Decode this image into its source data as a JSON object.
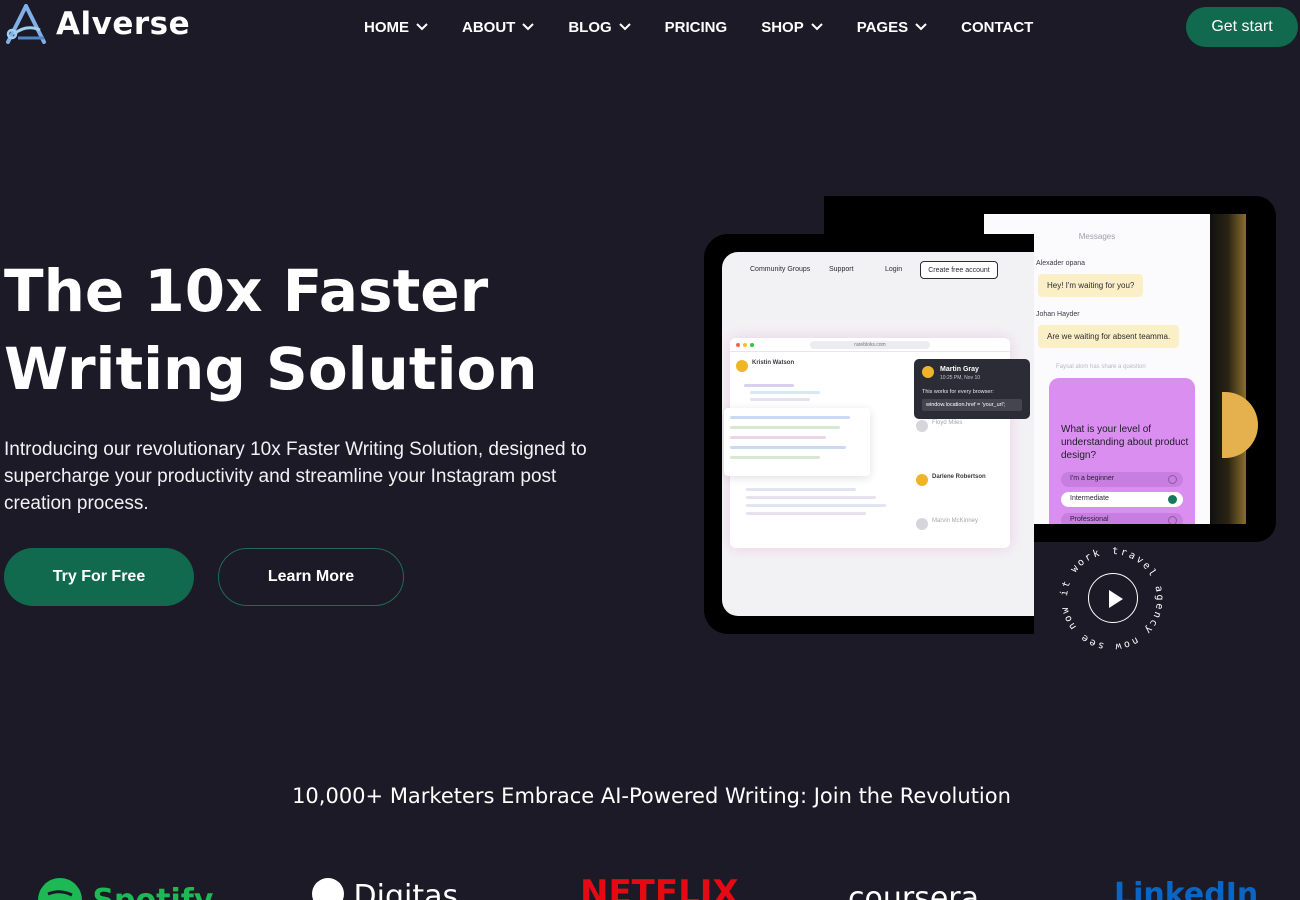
{
  "brand": {
    "name": "Alverse"
  },
  "nav": {
    "items": [
      {
        "label": "HOME",
        "has_dropdown": true
      },
      {
        "label": "ABOUT",
        "has_dropdown": true
      },
      {
        "label": "BLOG",
        "has_dropdown": true
      },
      {
        "label": "PRICING",
        "has_dropdown": false
      },
      {
        "label": "SHOP",
        "has_dropdown": true
      },
      {
        "label": "PAGES",
        "has_dropdown": true
      },
      {
        "label": "CONTACT",
        "has_dropdown": false
      }
    ],
    "cta_label": "Get start"
  },
  "hero": {
    "title_line1": "The 10x Faster",
    "title_line2": "Writing Solution",
    "description": "Introducing our revolutionary 10x Faster Writing Solution, designed to supercharge your productivity and streamline your Instagram post creation process.",
    "primary_button": "Try For Free",
    "secondary_button": "Learn More"
  },
  "mockup": {
    "nav": [
      "Community Groups",
      "Support",
      "Login"
    ],
    "create_account": "Create free account",
    "url": "rarebloks.com",
    "author": "Kristin Watson",
    "tooltip": {
      "name": "Martin Gray",
      "time": "10:25 PM, Nov 10",
      "text": "This works for every browser:",
      "code": "window.location.href = 'your_url';"
    },
    "list": [
      "Floyd Miles",
      "Darlene Robertson",
      "Marvin McKinney"
    ],
    "messages": {
      "header": "Messages",
      "sender1": "Alexader opana",
      "bubble1": "Hey! I'm waiting for you?",
      "sender2": "Johan Hayder",
      "bubble2": "Are we waiting for absent teamma.",
      "note": "Faysal alom has share a question",
      "question": "What is your level of understanding about product design?",
      "options": [
        "I'm a beginner",
        "Intermediate",
        "Professional"
      ],
      "selected": 1
    },
    "badge_text": "travel agency now see now it work"
  },
  "proof": {
    "title": "10,000+ Marketers Embrace AI-Powered Writing: Join the Revolution",
    "logos": [
      "Spotify",
      "Digitas",
      "NETFLIX",
      "coursera",
      "LinkedIn"
    ],
    "logo_colors": {
      "Spotify": "#1db954",
      "Digitas": "#ffffff",
      "NETFLIX": "#e50914",
      "coursera": "#ffffff",
      "LinkedIn": "#0a66c2"
    }
  },
  "colors": {
    "background": "#1b1a26",
    "accent": "#116a4d"
  }
}
